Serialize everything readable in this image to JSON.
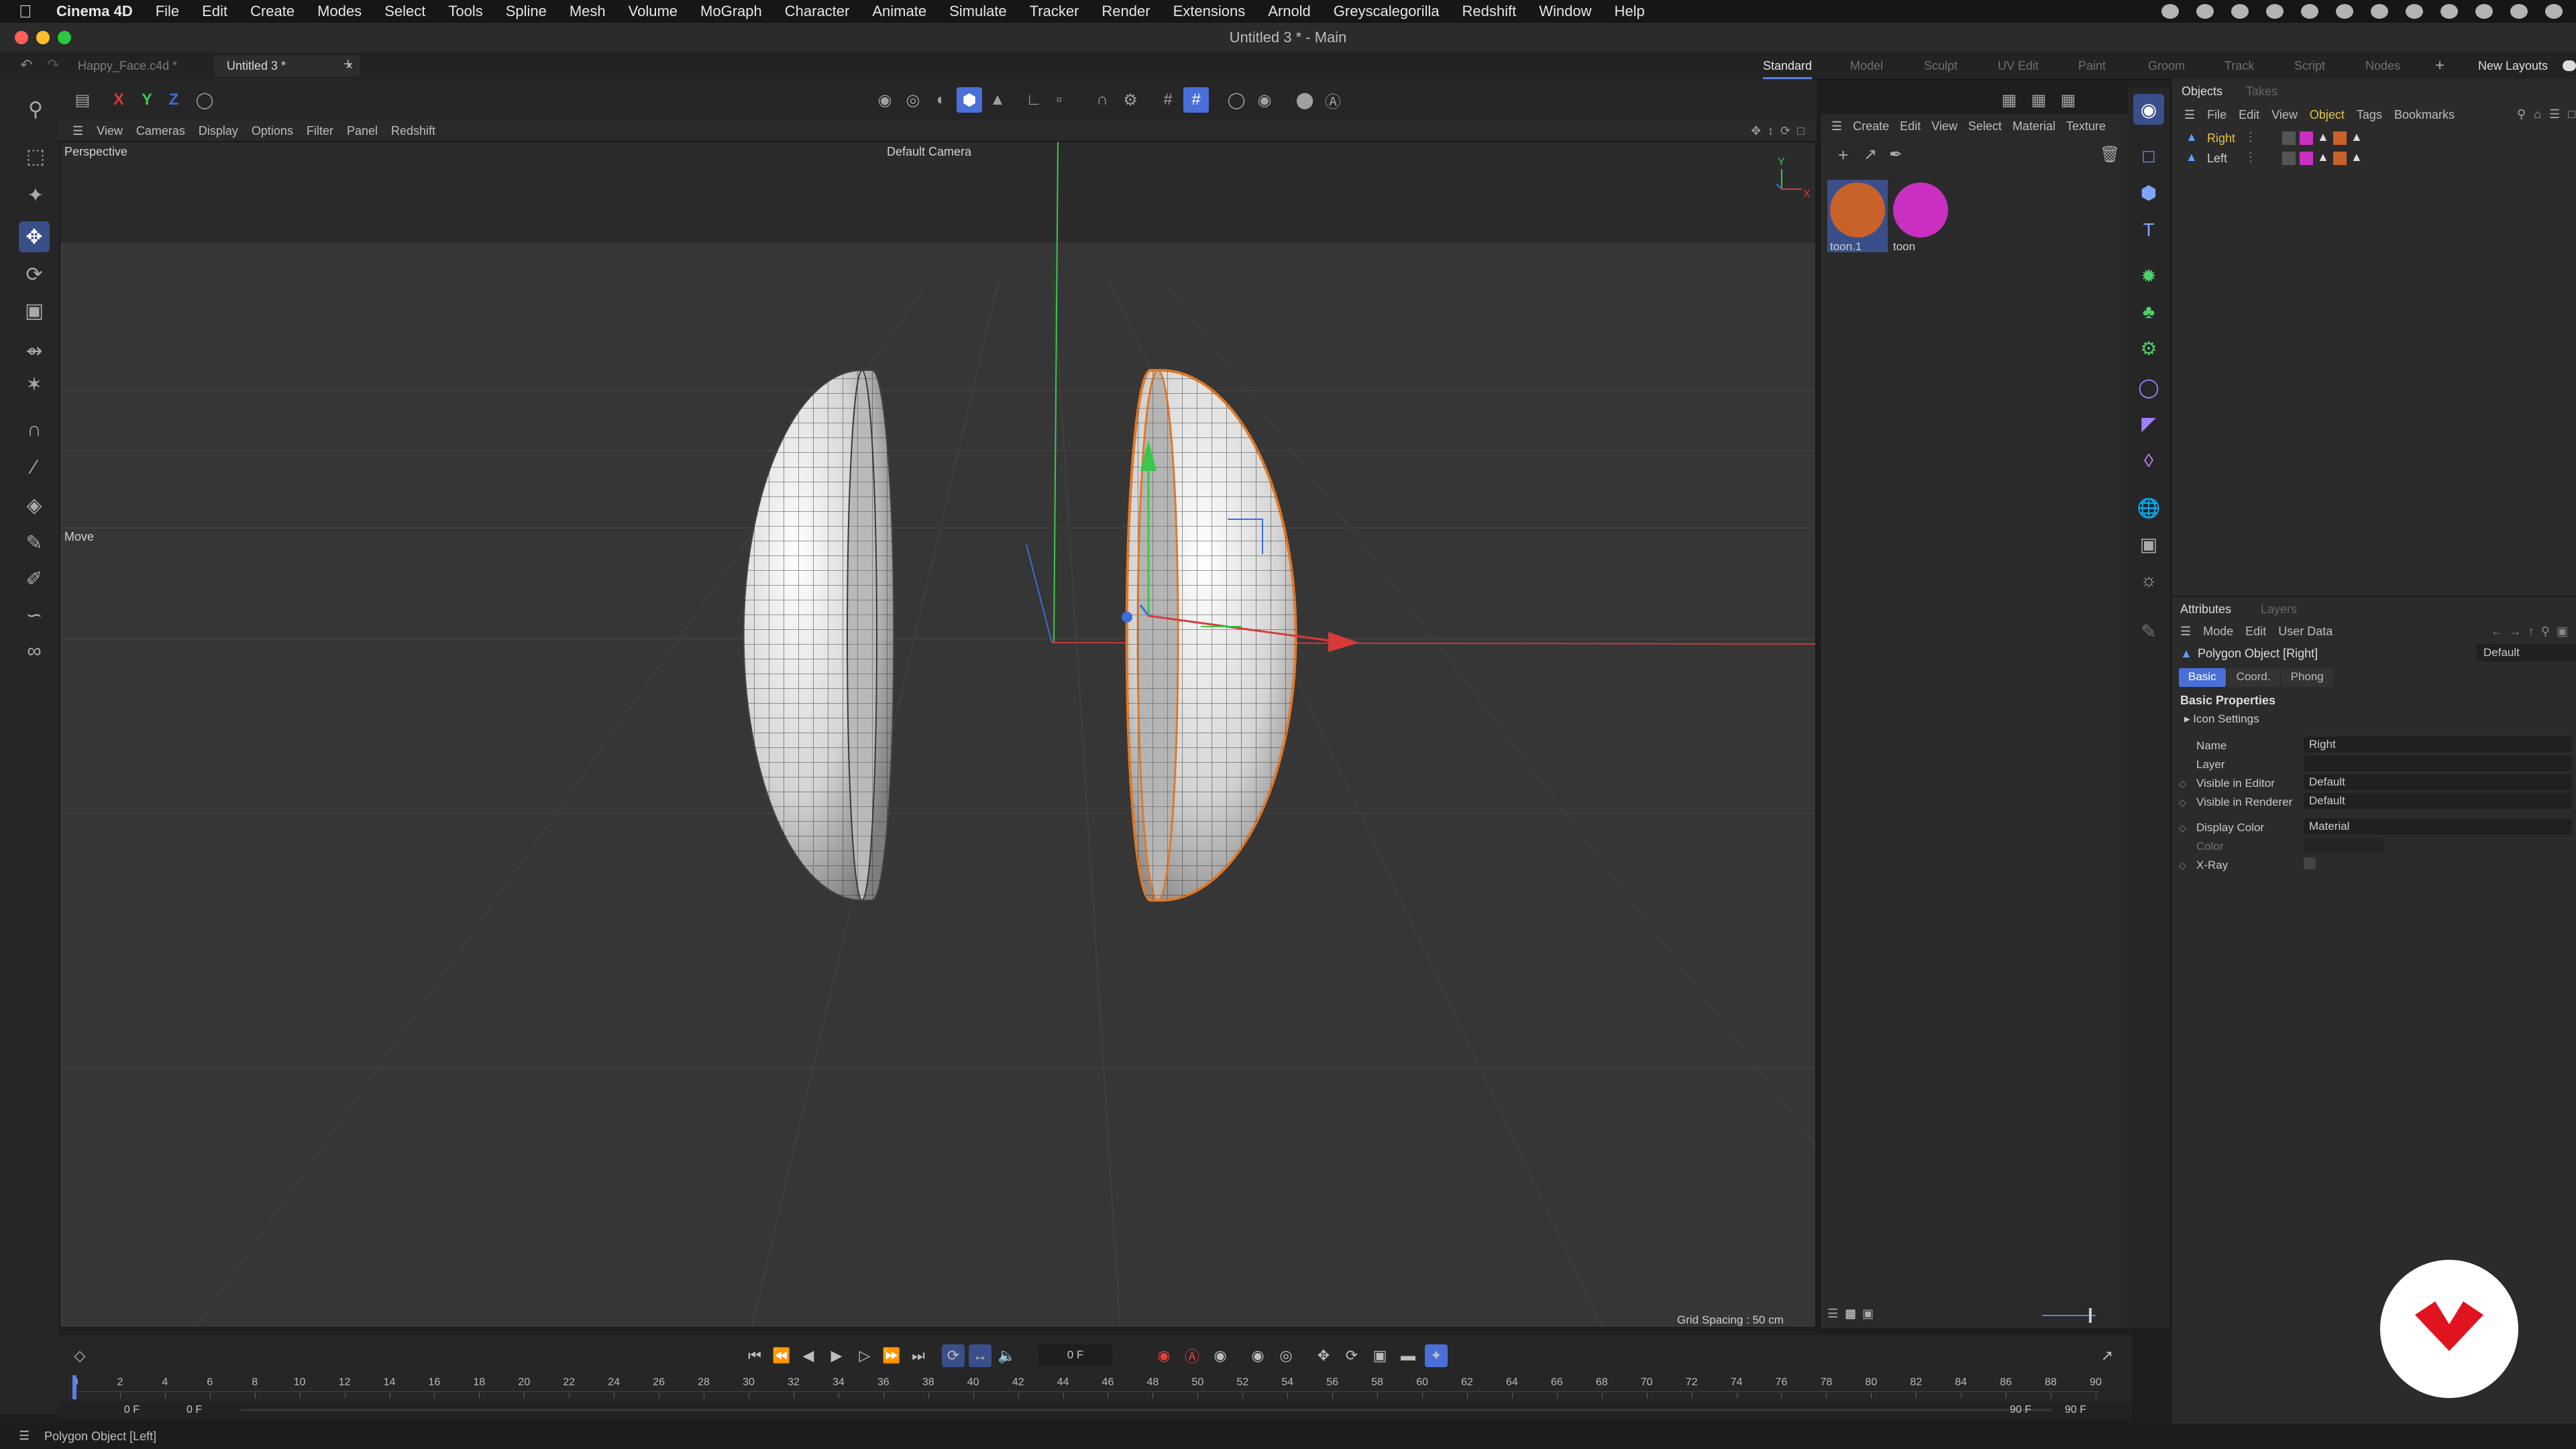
{
  "menubar": {
    "apple": "",
    "items": [
      "Cinema 4D",
      "File",
      "Edit",
      "Create",
      "Modes",
      "Select",
      "Tools",
      "Spline",
      "Mesh",
      "Volume",
      "MoGraph",
      "Character",
      "Animate",
      "Simulate",
      "Tracker",
      "Render",
      "Extensions",
      "Arnold",
      "Greyscalegorilla",
      "Redshift",
      "Window",
      "Help"
    ]
  },
  "window": {
    "title": "Untitled 3 * - Main"
  },
  "tabs": {
    "docs": [
      "Happy_Face.c4d *",
      "Untitled 3 *"
    ],
    "close": "×",
    "add": "+",
    "layouts": [
      "Standard",
      "Model",
      "Sculpt",
      "UV Edit",
      "Paint",
      "Groom",
      "Track",
      "Script",
      "Nodes"
    ],
    "new_layouts": "New Layouts"
  },
  "axes": {
    "x": "X",
    "y": "Y",
    "z": "Z"
  },
  "viewport_menu": [
    "View",
    "Cameras",
    "Display",
    "Options",
    "Filter",
    "Panel",
    "Redshift"
  ],
  "viewport": {
    "view_name": "Perspective",
    "camera": "Default Camera",
    "tool": "Move",
    "grid_spacing": "Grid Spacing : 50 cm",
    "axis_y": "Y",
    "axis_x": "X"
  },
  "material_menu": [
    "Create",
    "Edit",
    "View",
    "Select",
    "Material",
    "Texture"
  ],
  "materials": [
    {
      "name": "toon.1",
      "color": "#c8622a"
    },
    {
      "name": "toon",
      "color": "#c92fc0"
    }
  ],
  "objects_panel": {
    "tabs": [
      "Objects",
      "Takes"
    ],
    "menu": [
      "File",
      "Edit",
      "View",
      "Object",
      "Tags",
      "Bookmarks"
    ],
    "rows": [
      {
        "name": "Right",
        "color": "#e8c24a"
      },
      {
        "name": "Left",
        "color": "#cfcfcf"
      }
    ]
  },
  "attributes": {
    "tabs": [
      "Attributes",
      "Layers"
    ],
    "menu": [
      "Mode",
      "Edit",
      "User Data"
    ],
    "object_title": "Polygon Object [Right]",
    "preset": "Default",
    "subtabs": [
      "Basic",
      "Coord.",
      "Phong"
    ],
    "section": "Basic Properties",
    "subsection": "Icon Settings",
    "fields": [
      {
        "label": "Name",
        "value": "Right"
      },
      {
        "label": "Layer",
        "value": ""
      },
      {
        "label": "Visible in Editor",
        "value": "Default"
      },
      {
        "label": "Visible in Renderer",
        "value": "Default"
      },
      {
        "label": "Display Color",
        "value": "Material"
      },
      {
        "label": "Color",
        "value": ""
      },
      {
        "label": "X-Ray",
        "value": ""
      }
    ]
  },
  "timeline": {
    "current_frame": "0 F",
    "ticks": [
      "0",
      "2",
      "4",
      "6",
      "8",
      "10",
      "12",
      "14",
      "16",
      "18",
      "20",
      "22",
      "24",
      "26",
      "28",
      "30",
      "32",
      "34",
      "36",
      "38",
      "40",
      "42",
      "44",
      "46",
      "48",
      "50",
      "52",
      "54",
      "56",
      "58",
      "60",
      "62",
      "64",
      "66",
      "68",
      "70",
      "72",
      "74",
      "76",
      "78",
      "80",
      "82",
      "84",
      "86",
      "88",
      "90"
    ],
    "range_start": "0 F",
    "range_start2": "0 F",
    "range_end": "90 F",
    "range_end2": "90 F"
  },
  "status": {
    "text": "Polygon Object [Left]"
  },
  "colors": {
    "accent": "#5a7ee8",
    "selection": "#e07a2a",
    "axis_x": "#d83a3a",
    "axis_y": "#3ac84a",
    "axis_z": "#3a6ed8",
    "logo": "#e0141e"
  },
  "icons": {
    "left_toolbar": [
      "search-icon",
      "select-icon",
      "snap-icon",
      "move-icon",
      "rotate-icon",
      "scale-icon",
      "transfer-icon",
      "tweak-icon",
      "magnet-icon",
      "knife-icon",
      "extrude-icon",
      "brush-icon",
      "pen-icon",
      "spline-pen-icon",
      "lasso-icon"
    ],
    "right_toolbar": [
      "object-mode-icon",
      "polygon-icon",
      "cube-icon",
      "text-icon",
      "generator-icon",
      "mograph-cloner-icon",
      "deformer-icon",
      "field-icon",
      "spline-icon",
      "nodes-icon",
      "globe-icon",
      "camera-icon",
      "light-icon"
    ]
  }
}
